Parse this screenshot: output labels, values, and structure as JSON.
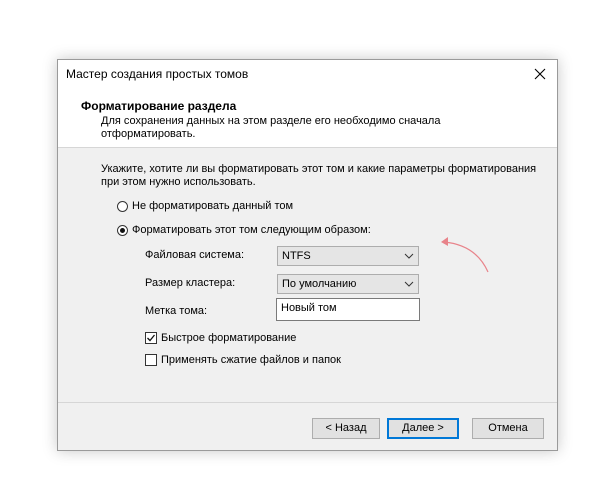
{
  "window": {
    "title": "Мастер создания простых томов",
    "close_icon": "close-icon"
  },
  "header": {
    "title": "Форматирование раздела",
    "description": "Для сохранения данных на этом разделе его необходимо сначала отформатировать."
  },
  "body": {
    "instructions": "Укажите, хотите ли вы форматировать этот том и какие параметры форматирования при этом нужно использовать.",
    "radio_no_format": {
      "label": "Не форматировать данный том",
      "checked": false
    },
    "radio_format": {
      "label": "Форматировать этот том следующим образом:",
      "checked": true
    },
    "fields": {
      "filesystem": {
        "label": "Файловая система:",
        "value": "NTFS"
      },
      "cluster_size": {
        "label": "Размер кластера:",
        "value": "По умолчанию"
      },
      "volume_label": {
        "label": "Метка тома:",
        "value": "Новый том"
      }
    },
    "quick_format": {
      "label": "Быстрое форматирование",
      "checked": true
    },
    "compression": {
      "label": "Применять сжатие файлов и папок",
      "checked": false
    }
  },
  "buttons": {
    "back": "< Назад",
    "next": "Далее >",
    "cancel": "Отмена"
  },
  "colors": {
    "annotation_arrow": "#e8838a",
    "focus_border": "#0078d7"
  }
}
